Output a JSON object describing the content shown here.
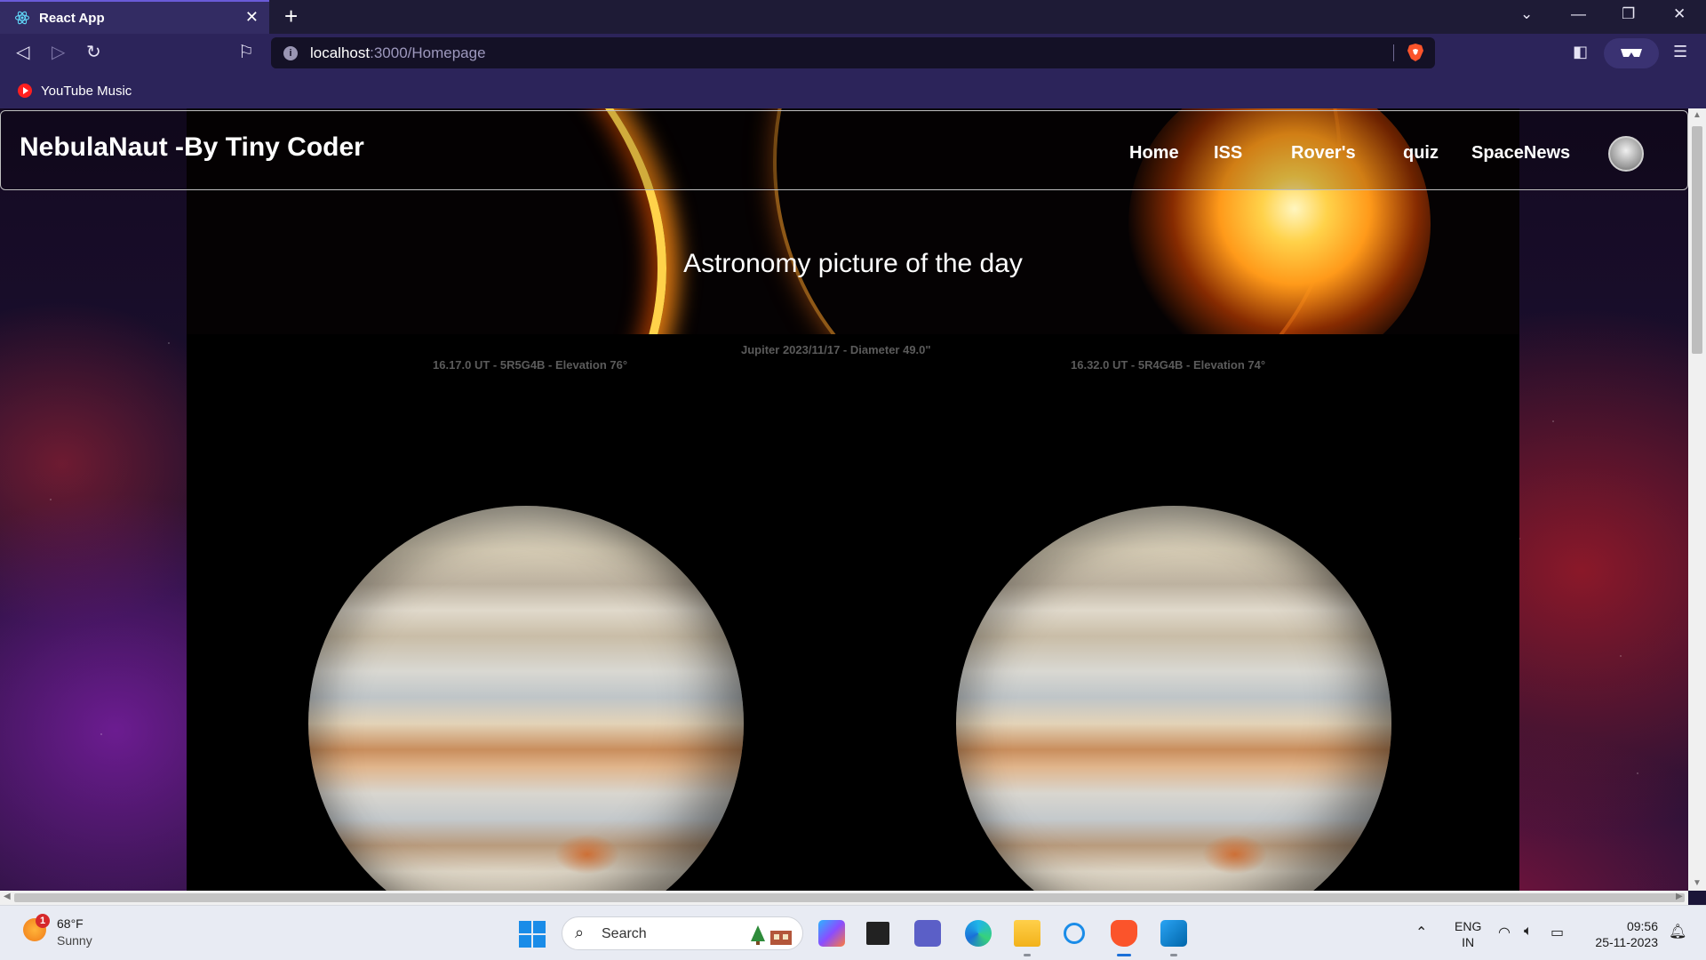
{
  "browser": {
    "tab_title": "React App",
    "url_host": "localhost",
    "url_path": ":3000/Homepage",
    "bookmark_label": "YouTube Music",
    "colors": {
      "tab_active": "#332c63",
      "toolbar": "#2c245a",
      "urlbar": "#141126"
    }
  },
  "site": {
    "brand": "NebulaNaut -By Tiny Coder",
    "nav": [
      "Home",
      "ISS",
      "Rover's",
      "quiz",
      "SpaceNews"
    ],
    "apod_heading": "Astronomy picture of the day",
    "apod_caption_center": "Jupiter  2023/11/17 - Diameter 49.0\"",
    "apod_caption_left": "16.17.0 UT - 5R5G4B - Elevation 76°",
    "apod_caption_right": "16.32.0 UT - 5R4G4B - Elevation 74°"
  },
  "taskbar": {
    "weather_temp": "68°F",
    "weather_condition": "Sunny",
    "weather_badge": "1",
    "search_label": "Search",
    "lang_line1": "ENG",
    "lang_line2": "IN",
    "time": "09:56",
    "date": "25-11-2023"
  },
  "icons": [
    "react-icon",
    "close-icon",
    "plus-icon",
    "chevron-down-icon",
    "minimize-icon",
    "restore-icon",
    "back-icon",
    "forward-icon",
    "reload-icon",
    "bookmark-icon",
    "info-icon",
    "brave-shield-icon",
    "sidebar-icon",
    "wallet-icon",
    "menu-icon",
    "youtube-music-icon",
    "windows-start-icon",
    "search-icon",
    "copilot-icon",
    "task-view-icon",
    "teams-icon",
    "edge-icon",
    "file-explorer-icon",
    "cortana-icon",
    "brave-icon",
    "vscode-icon",
    "wifi-icon",
    "volume-icon",
    "battery-icon",
    "notification-bell-icon"
  ]
}
